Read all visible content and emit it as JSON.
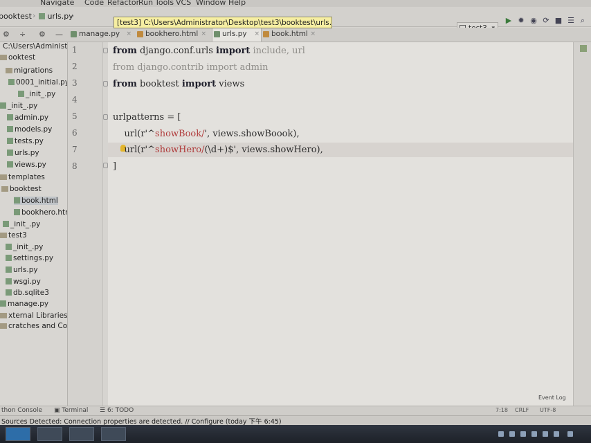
{
  "menu": [
    "Navigate",
    "Code",
    "Refactor",
    "Run",
    "Tools",
    "VCS",
    "Window",
    "Help"
  ],
  "breadcrumb": {
    "project": "booktest",
    "file": "urls.py"
  },
  "tooltip": "[test3] C:\\Users\\Administrator\\Desktop\\test3\\booktest\\urls.py",
  "run_config": "test3",
  "tabs": [
    {
      "label": "manage.py",
      "active": false
    },
    {
      "label": "bookhero.html",
      "active": false
    },
    {
      "label": "urls.py",
      "active": true
    },
    {
      "label": "book.html",
      "active": false
    }
  ],
  "tree": [
    {
      "label": "C:\\Users\\Administ",
      "kind": "path"
    },
    {
      "label": "ooktest",
      "kind": "dir"
    },
    {
      "label": "migrations",
      "kind": "dir"
    },
    {
      "label": "0001_initial.py",
      "kind": "file"
    },
    {
      "label": "_init_.py",
      "kind": "file"
    },
    {
      "label": "_init_.py",
      "kind": "file"
    },
    {
      "label": "admin.py",
      "kind": "file"
    },
    {
      "label": "models.py",
      "kind": "file"
    },
    {
      "label": "tests.py",
      "kind": "file"
    },
    {
      "label": "urls.py",
      "kind": "file"
    },
    {
      "label": "views.py",
      "kind": "file"
    },
    {
      "label": "templates",
      "kind": "dir"
    },
    {
      "label": "booktest",
      "kind": "dir"
    },
    {
      "label": "book.html",
      "kind": "file"
    },
    {
      "label": "bookhero.html",
      "kind": "file"
    },
    {
      "label": "_init_.py",
      "kind": "file"
    },
    {
      "label": "test3",
      "kind": "dir"
    },
    {
      "label": "_init_.py",
      "kind": "file"
    },
    {
      "label": "settings.py",
      "kind": "file"
    },
    {
      "label": "urls.py",
      "kind": "file"
    },
    {
      "label": "wsgi.py",
      "kind": "file"
    },
    {
      "label": "db.sqlite3",
      "kind": "file"
    },
    {
      "label": "manage.py",
      "kind": "file"
    },
    {
      "label": "xternal Libraries",
      "kind": "dir"
    },
    {
      "label": "cratches and Consoles",
      "kind": "dir"
    }
  ],
  "line_numbers": [
    "1",
    "2",
    "3",
    "4",
    "5",
    "6",
    "7",
    "8"
  ],
  "code": {
    "l1": {
      "from": "from",
      "module": " django.conf.urls ",
      "import": "import",
      "names": " include, url"
    },
    "l2": "from django.contrib import admin",
    "l3": {
      "from": "from",
      "module": " booktest ",
      "import": "import",
      "names": " views"
    },
    "l5": "urlpatterns = [",
    "l6": {
      "pre": "    url(r'^",
      "pattern": "showBook/",
      "post": "', views.showBoook),"
    },
    "l7": {
      "pre": "    url(r'^",
      "pattern": "showHero/",
      "post": "(\\d+)$', views.showHero),"
    },
    "l8": "]"
  },
  "bottom_tools": {
    "console": "thon Console",
    "terminal": "Terminal",
    "todo": "6: TODO",
    "event_log": "Event Log"
  },
  "status": {
    "message": "Sources Detected: Connection properties are detected. // Configure (today 下午 6:45)",
    "position": "7:18",
    "line_sep": "CRLF",
    "encoding": "UTF-8"
  }
}
